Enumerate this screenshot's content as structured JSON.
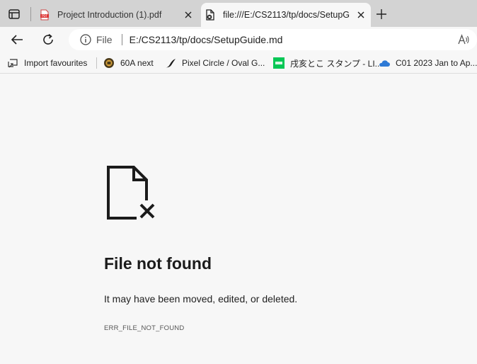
{
  "tabs": [
    {
      "title": "Project Introduction (1).pdf",
      "active": false,
      "favicon": "pdf-icon"
    },
    {
      "title": "file:///E:/CS2113/tp/docs/SetupG",
      "active": true,
      "favicon": "file-error-icon"
    }
  ],
  "toolbar": {
    "scheme_label": "File",
    "url": "E:/CS2113/tp/docs/SetupGuide.md"
  },
  "favourites": [
    {
      "label": "Import favourites",
      "icon": "import-icon"
    },
    {
      "label": "60A next",
      "icon": "bus-icon"
    },
    {
      "label": "Pixel Circle / Oval G...",
      "icon": "pixel-icon"
    },
    {
      "label": "戌亥とこ スタンプ - LI...",
      "icon": "line-icon"
    },
    {
      "label": "C01 2023 Jan to Ap...",
      "icon": "onedrive-icon"
    }
  ],
  "error": {
    "title": "File not found",
    "message": "It may have been moved, edited, or deleted.",
    "code": "ERR_FILE_NOT_FOUND"
  },
  "colors": {
    "tabstrip": "#d3d3d3",
    "page_bg": "#f7f7f7",
    "line_green": "#06c755",
    "onedrive_blue": "#2e7ad6"
  }
}
